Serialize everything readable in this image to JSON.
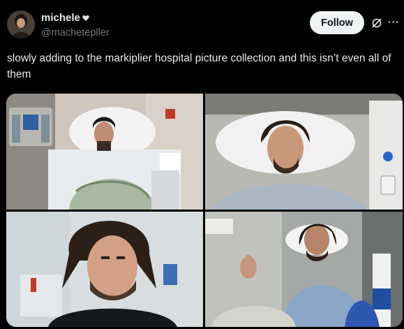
{
  "user": {
    "display_name": "michele",
    "handle": "@machetepller",
    "follow_label": "Follow"
  },
  "tweet": {
    "text": "slowly adding to the markiplier hospital picture collection and this isn’t even all of them"
  },
  "media": {
    "photos": [
      {
        "name": "hospital-photo-1"
      },
      {
        "name": "hospital-photo-2"
      },
      {
        "name": "selfie-photo-3"
      },
      {
        "name": "hospital-photo-4"
      }
    ]
  },
  "colors": {
    "background": "#000000",
    "text": "#e7e9ea",
    "secondary_text": "#71767b",
    "follow_button_bg": "#eff3f4"
  },
  "icons": [
    "avatar",
    "heart-icon",
    "grok-icon",
    "more-icon"
  ]
}
